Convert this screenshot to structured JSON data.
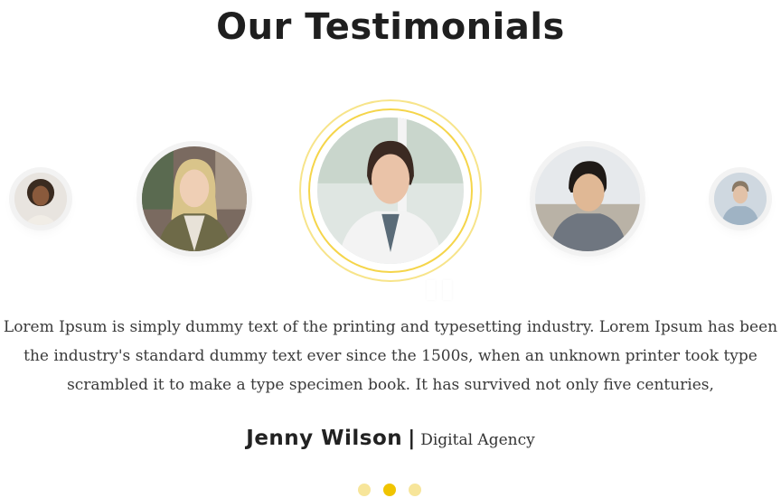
{
  "header": {
    "title_prefix": "Our",
    "title_highlight": "Testimonials"
  },
  "testimonial": {
    "text_lines": [
      "Lorem Ipsum is simply dummy text of the printing and typesetting industry. Lorem Ipsum has been",
      "the industry's standard dummy text ever since the 1500s, when an unknown printer took  type",
      "scrambled it to make a type specimen book. It has survived not only five centuries,"
    ],
    "author_name": "Jenny Wilson",
    "separator": "|",
    "author_company": "Digital Agency"
  },
  "carousel": {
    "avatars": [
      "avatar-1",
      "avatar-2",
      "avatar-active",
      "avatar-4",
      "avatar-5"
    ],
    "quote_icon": "quote-icon",
    "dots": {
      "count": 3,
      "active_index": 1
    }
  },
  "colors": {
    "accent": "#f0c400",
    "accent_light": "#f7e59a",
    "title": "#1f1f1f",
    "text": "#3a3a3a"
  }
}
